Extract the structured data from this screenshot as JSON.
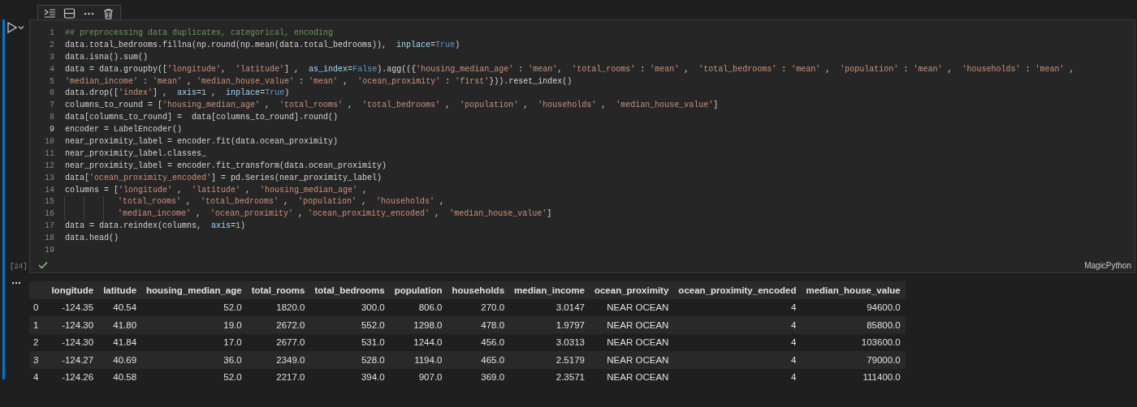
{
  "cell": {
    "toolbar": [
      {
        "kind": "run-by-line"
      },
      {
        "kind": "split"
      },
      {
        "kind": "more"
      },
      {
        "kind": "delete"
      }
    ],
    "execution_count": "[24]",
    "run_succeeded": true,
    "language": "MagicPython",
    "lines": [
      {
        "number": "1",
        "current": false,
        "tokens": [
          {
            "kind": "comment",
            "text": "## preprocessing data duplicates, categorical, encoding"
          }
        ]
      },
      {
        "number": "2",
        "current": false,
        "tokens": [
          {
            "kind": "text",
            "text": "data.total_bedrooms.fillna(np.round(np.mean(data.total_bedrooms)),  "
          },
          {
            "kind": "param",
            "text": "inplace"
          },
          {
            "kind": "text",
            "text": "="
          },
          {
            "kind": "keyword",
            "text": "True"
          },
          {
            "kind": "text",
            "text": ")"
          }
        ]
      },
      {
        "number": "3",
        "current": false,
        "tokens": [
          {
            "kind": "text",
            "text": "data.isna().sum()"
          }
        ]
      },
      {
        "number": "4",
        "current": false,
        "tokens": [
          {
            "kind": "text",
            "text": "data = data.groupby(["
          },
          {
            "kind": "string",
            "text": "'longitude'"
          },
          {
            "kind": "text",
            "text": ",  "
          },
          {
            "kind": "string",
            "text": "'latitude'"
          },
          {
            "kind": "text",
            "text": "] ,  "
          },
          {
            "kind": "param",
            "text": "as_index"
          },
          {
            "kind": "text",
            "text": "="
          },
          {
            "kind": "keyword",
            "text": "False"
          },
          {
            "kind": "text",
            "text": ").agg(({"
          },
          {
            "kind": "string",
            "text": "'housing_median_age'"
          },
          {
            "kind": "text",
            "text": " : "
          },
          {
            "kind": "string",
            "text": "'mean'"
          },
          {
            "kind": "text",
            "text": ",  "
          },
          {
            "kind": "string",
            "text": "'total_rooms'"
          },
          {
            "kind": "text",
            "text": " : "
          },
          {
            "kind": "string",
            "text": "'mean'"
          },
          {
            "kind": "text",
            "text": " ,  "
          },
          {
            "kind": "string",
            "text": "'total_bedrooms'"
          },
          {
            "kind": "text",
            "text": " : "
          },
          {
            "kind": "string",
            "text": "'mean'"
          },
          {
            "kind": "text",
            "text": " ,  "
          },
          {
            "kind": "string",
            "text": "'population'"
          },
          {
            "kind": "text",
            "text": " : "
          },
          {
            "kind": "string",
            "text": "'mean'"
          },
          {
            "kind": "text",
            "text": " ,  "
          },
          {
            "kind": "string",
            "text": "'households'"
          },
          {
            "kind": "text",
            "text": " : "
          },
          {
            "kind": "string",
            "text": "'mean'"
          },
          {
            "kind": "text",
            "text": " ,"
          }
        ]
      },
      {
        "number": "5",
        "current": false,
        "tokens": [
          {
            "kind": "string",
            "text": "'median_income'"
          },
          {
            "kind": "text",
            "text": " : "
          },
          {
            "kind": "string",
            "text": "'mean'"
          },
          {
            "kind": "text",
            "text": " , "
          },
          {
            "kind": "string",
            "text": "'median_house_value'"
          },
          {
            "kind": "text",
            "text": " : "
          },
          {
            "kind": "string",
            "text": "'mean'"
          },
          {
            "kind": "text",
            "text": " ,  "
          },
          {
            "kind": "string",
            "text": "'ocean_proximity'"
          },
          {
            "kind": "text",
            "text": " : "
          },
          {
            "kind": "string",
            "text": "'first'"
          },
          {
            "kind": "text",
            "text": "})).reset_index()"
          }
        ]
      },
      {
        "number": "6",
        "current": false,
        "tokens": [
          {
            "kind": "text",
            "text": "data.drop(["
          },
          {
            "kind": "string",
            "text": "'index'"
          },
          {
            "kind": "text",
            "text": "] ,  "
          },
          {
            "kind": "param",
            "text": "axis"
          },
          {
            "kind": "text",
            "text": "="
          },
          {
            "kind": "number",
            "text": "1"
          },
          {
            "kind": "text",
            "text": " ,  "
          },
          {
            "kind": "param",
            "text": "inplace"
          },
          {
            "kind": "text",
            "text": "="
          },
          {
            "kind": "keyword",
            "text": "True"
          },
          {
            "kind": "text",
            "text": ")"
          }
        ]
      },
      {
        "number": "7",
        "current": false,
        "tokens": [
          {
            "kind": "text",
            "text": "columns_to_round = ["
          },
          {
            "kind": "string",
            "text": "'housing_median_age'"
          },
          {
            "kind": "text",
            "text": " ,  "
          },
          {
            "kind": "string",
            "text": "'total_rooms'"
          },
          {
            "kind": "text",
            "text": " ,  "
          },
          {
            "kind": "string",
            "text": "'total_bedrooms'"
          },
          {
            "kind": "text",
            "text": " ,  "
          },
          {
            "kind": "string",
            "text": "'population'"
          },
          {
            "kind": "text",
            "text": " ,  "
          },
          {
            "kind": "string",
            "text": "'households'"
          },
          {
            "kind": "text",
            "text": " ,  "
          },
          {
            "kind": "string",
            "text": "'median_house_value'"
          },
          {
            "kind": "text",
            "text": "]"
          }
        ]
      },
      {
        "number": "8",
        "current": false,
        "tokens": [
          {
            "kind": "text",
            "text": "data[columns_to_round] =  data[columns_to_round].round()"
          }
        ]
      },
      {
        "number": "9",
        "current": true,
        "tokens": [
          {
            "kind": "text",
            "text": "encoder = LabelEncoder()"
          }
        ]
      },
      {
        "number": "10",
        "current": false,
        "tokens": [
          {
            "kind": "text",
            "text": "near_proximity_label = encoder.fit(data.ocean_proximity)"
          }
        ]
      },
      {
        "number": "11",
        "current": false,
        "tokens": [
          {
            "kind": "text",
            "text": "near_proximity_label.classes_"
          }
        ]
      },
      {
        "number": "12",
        "current": false,
        "tokens": [
          {
            "kind": "text",
            "text": "near_proximity_label = encoder.fit_transform(data.ocean_proximity)"
          }
        ]
      },
      {
        "number": "13",
        "current": false,
        "tokens": [
          {
            "kind": "text",
            "text": "data["
          },
          {
            "kind": "string",
            "text": "'ocean_proximity_encoded'"
          },
          {
            "kind": "text",
            "text": "] = pd.Series(near_proximity_label)"
          }
        ]
      },
      {
        "number": "14",
        "current": false,
        "tokens": [
          {
            "kind": "text",
            "text": "columns = ["
          },
          {
            "kind": "string",
            "text": "'longitude'"
          },
          {
            "kind": "text",
            "text": " ,  "
          },
          {
            "kind": "string",
            "text": "'latitude'"
          },
          {
            "kind": "text",
            "text": " ,  "
          },
          {
            "kind": "string",
            "text": "'housing_median_age'"
          },
          {
            "kind": "text",
            "text": " ,"
          }
        ]
      },
      {
        "number": "15",
        "current": false,
        "continuation": true,
        "tokens": [
          {
            "kind": "string",
            "text": "'total_rooms'"
          },
          {
            "kind": "text",
            "text": " ,  "
          },
          {
            "kind": "string",
            "text": "'total_bedrooms'"
          },
          {
            "kind": "text",
            "text": " ,  "
          },
          {
            "kind": "string",
            "text": "'population'"
          },
          {
            "kind": "text",
            "text": " ,  "
          },
          {
            "kind": "string",
            "text": "'households'"
          },
          {
            "kind": "text",
            "text": " ,"
          }
        ]
      },
      {
        "number": "16",
        "current": false,
        "continuation": true,
        "tokens": [
          {
            "kind": "string",
            "text": "'median_income'"
          },
          {
            "kind": "text",
            "text": " ,  "
          },
          {
            "kind": "string",
            "text": "'ocean_proximity'"
          },
          {
            "kind": "text",
            "text": " , "
          },
          {
            "kind": "string",
            "text": "'ocean_proximity_encoded'"
          },
          {
            "kind": "text",
            "text": " ,  "
          },
          {
            "kind": "string",
            "text": "'median_house_value'"
          },
          {
            "kind": "text",
            "text": "]"
          }
        ]
      },
      {
        "number": "17",
        "current": false,
        "tokens": [
          {
            "kind": "text",
            "text": "data = data.reindex(columns,  "
          },
          {
            "kind": "param",
            "text": "axis"
          },
          {
            "kind": "text",
            "text": "="
          },
          {
            "kind": "number",
            "text": "1"
          },
          {
            "kind": "text",
            "text": ")"
          }
        ]
      },
      {
        "number": "18",
        "current": false,
        "tokens": [
          {
            "kind": "text",
            "text": "data.head()"
          }
        ]
      },
      {
        "number": "19",
        "current": false
      }
    ]
  },
  "output": {
    "table": {
      "columns": [
        "longitude",
        "latitude",
        "housing_median_age",
        "total_rooms",
        "total_bedrooms",
        "population",
        "households",
        "median_income",
        "ocean_proximity",
        "ocean_proximity_encoded",
        "median_house_value"
      ],
      "rows": [
        {
          "index": "0",
          "cells": [
            "-124.35",
            "40.54",
            "52.0",
            "1820.0",
            "300.0",
            "806.0",
            "270.0",
            "3.0147",
            "NEAR OCEAN",
            "4",
            "94600.0"
          ]
        },
        {
          "index": "1",
          "cells": [
            "-124.30",
            "41.80",
            "19.0",
            "2672.0",
            "552.0",
            "1298.0",
            "478.0",
            "1.9797",
            "NEAR OCEAN",
            "4",
            "85800.0"
          ]
        },
        {
          "index": "2",
          "cells": [
            "-124.30",
            "41.84",
            "17.0",
            "2677.0",
            "531.0",
            "1244.0",
            "456.0",
            "3.0313",
            "NEAR OCEAN",
            "4",
            "103600.0"
          ]
        },
        {
          "index": "3",
          "cells": [
            "-124.27",
            "40.69",
            "36.0",
            "2349.0",
            "528.0",
            "1194.0",
            "465.0",
            "2.5179",
            "NEAR OCEAN",
            "4",
            "79000.0"
          ]
        },
        {
          "index": "4",
          "cells": [
            "-124.26",
            "40.58",
            "52.0",
            "2217.0",
            "394.0",
            "907.0",
            "369.0",
            "2.3571",
            "NEAR OCEAN",
            "4",
            "111400.0"
          ]
        }
      ]
    }
  }
}
